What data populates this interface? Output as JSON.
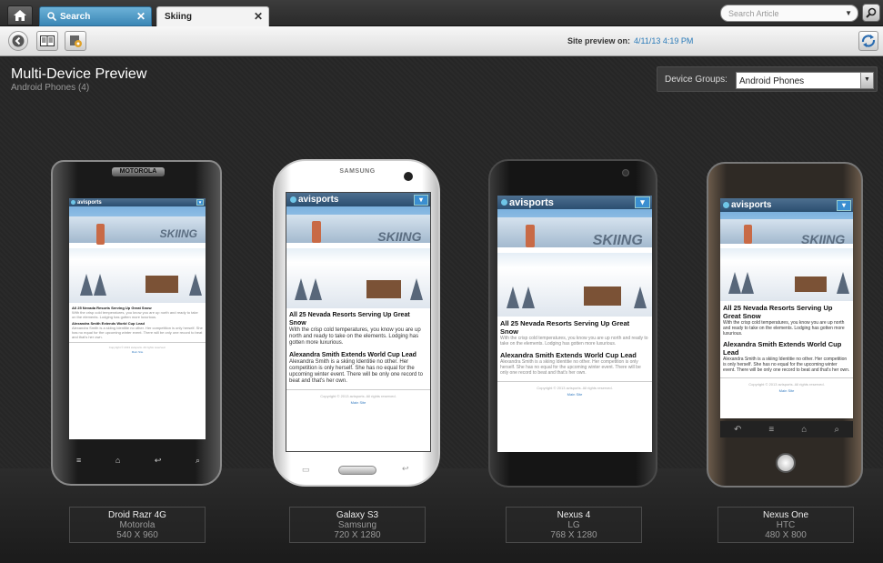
{
  "tabs": {
    "search_label": "Search",
    "skiing_label": "Skiing"
  },
  "search_article": {
    "placeholder": "Search Article"
  },
  "toolbar": {
    "preview_label": "Site preview on:",
    "preview_time": "4/11/13 4:19 PM"
  },
  "page": {
    "title": "Multi-Device Preview",
    "subtitle": "Android Phones (4)"
  },
  "device_groups": {
    "label": "Device Groups:",
    "selected": "Android Phones"
  },
  "site": {
    "logo": "avisports",
    "hero_text": "SKIING",
    "article1_title": "All 25 Nevada Resorts Serving Up Great Snow",
    "article1_body": "With the crisp cold temperatures, you know you are up north and ready to take on the elements. Lodging has gotten more luxurious.",
    "article2_title": "Alexandra Smith Extends World Cup Lead",
    "article2_body": "Alexandra Smith is a skiing Identitie no other. Her competition is only herself. She has no equal for the upcoming winter event. There will be only one record to beat and that's her own.",
    "footer_copy": "Copyright © 2013 avisports. All rights reserved.",
    "footer_link": "Main Site"
  },
  "devices": [
    {
      "name": "Droid Razr 4G",
      "maker": "Motorola",
      "resolution": "540 X 960",
      "brand": "MOTOROLA"
    },
    {
      "name": "Galaxy S3",
      "maker": "Samsung",
      "resolution": "720 X 1280",
      "brand": "SAMSUNG"
    },
    {
      "name": "Nexus 4",
      "maker": "LG",
      "resolution": "768 X 1280"
    },
    {
      "name": "Nexus One",
      "maker": "HTC",
      "resolution": "480 X 800"
    }
  ],
  "colors": {
    "accent": "#2b7bb9",
    "tab_active_bg": "#f3f3f3",
    "tab_search_bg": "#3a86b5",
    "header_bg": "#2b4e70"
  },
  "icons": [
    "home-icon",
    "search-icon",
    "close-icon",
    "back-icon",
    "columns-icon",
    "settings-icon",
    "sync-icon",
    "menu-icon"
  ]
}
